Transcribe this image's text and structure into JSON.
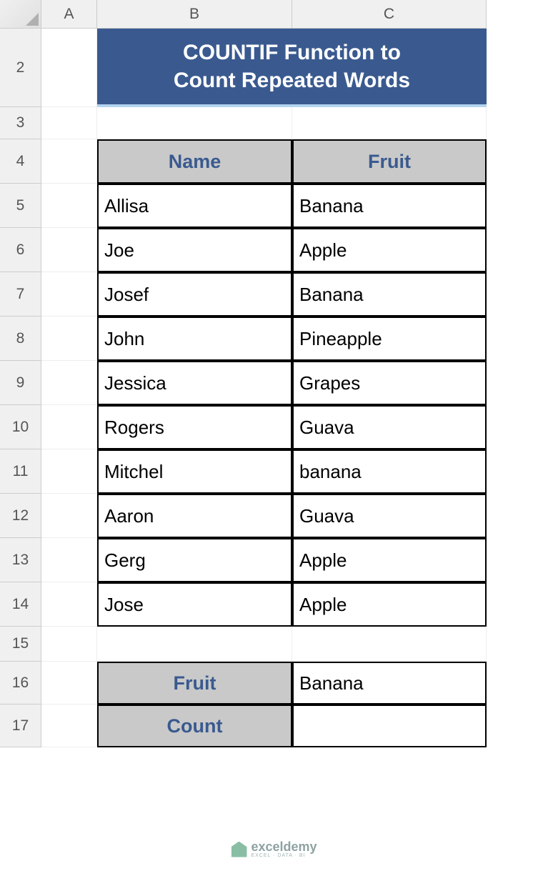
{
  "columns": [
    "A",
    "B",
    "C"
  ],
  "rows": [
    "2",
    "3",
    "4",
    "5",
    "6",
    "7",
    "8",
    "9",
    "10",
    "11",
    "12",
    "13",
    "14",
    "15",
    "16",
    "17"
  ],
  "title": {
    "line1": "COUNTIF Function to",
    "line2": "Count Repeated Words"
  },
  "table": {
    "headers": {
      "name": "Name",
      "fruit": "Fruit"
    },
    "rows": [
      {
        "name": "Allisa",
        "fruit": "Banana"
      },
      {
        "name": "Joe",
        "fruit": "Apple"
      },
      {
        "name": "Josef",
        "fruit": "Banana"
      },
      {
        "name": "John",
        "fruit": "Pineapple"
      },
      {
        "name": "Jessica",
        "fruit": "Grapes"
      },
      {
        "name": "Rogers",
        "fruit": "Guava"
      },
      {
        "name": "Mitchel",
        "fruit": "banana"
      },
      {
        "name": "Aaron",
        "fruit": "Guava"
      },
      {
        "name": "Gerg",
        "fruit": "Apple"
      },
      {
        "name": "Jose",
        "fruit": "Apple"
      }
    ]
  },
  "summary": {
    "fruit_label": "Fruit",
    "fruit_value": "Banana",
    "count_label": "Count",
    "count_value": ""
  },
  "watermark": {
    "main": "exceldemy",
    "sub": "EXCEL · DATA · BI"
  }
}
